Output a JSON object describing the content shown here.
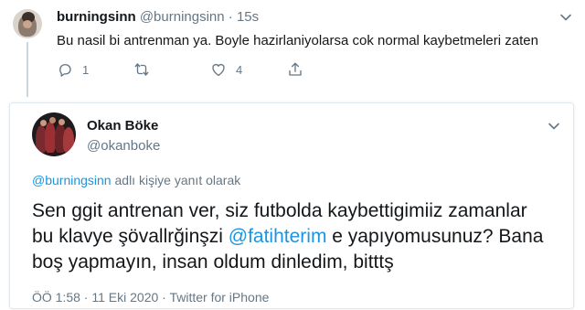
{
  "top_tweet": {
    "name": "burningsinn",
    "handle": "@burningsinn",
    "separator": "·",
    "time": "15s",
    "text": "Bu nasil bi antrenman ya. Boyle hazirlaniyolarsa cok normal kaybetmeleri zaten",
    "reply_count": "1",
    "retweet_count": "",
    "like_count": "4"
  },
  "quoted_tweet": {
    "name": "Okan Böke",
    "handle": "@okanboke",
    "reply_to_mention": "@burningsinn",
    "reply_to_suffix": " adlı kişiye yanıt olarak",
    "text_part1": "Sen ggit antrenan ver, siz futbolda kaybettigimiiz zamanlar bu klavye şövallrğinşzi ",
    "text_mention": "@fatihterim",
    "text_part2": " e yapıyomusunuz? Bana boş yapmayın, insan oldum dinledim, bitttş",
    "meta": "ÖÖ 1:58 · 11 Eki 2020 · Twitter for iPhone"
  },
  "icons": [
    "reply-icon",
    "retweet-icon",
    "like-icon",
    "share-icon",
    "chevron-down-icon"
  ],
  "colors": {
    "link": "#1b95e0",
    "secondary": "#657786",
    "text": "#14171a",
    "border": "#e1e8ed"
  }
}
